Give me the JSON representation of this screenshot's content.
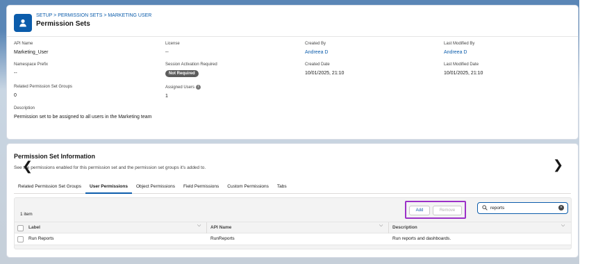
{
  "header": {
    "breadcrumb": "SETUP > PERMISSION SETS > MARKETING USER",
    "title": "Permission Sets",
    "icon": "user-icon"
  },
  "details": {
    "api_name": {
      "label": "API Name",
      "value": "Marketing_User"
    },
    "license": {
      "label": "License",
      "value": "--"
    },
    "created_by": {
      "label": "Created By",
      "value": "Andreea D"
    },
    "last_modified_by": {
      "label": "Last Modified By",
      "value": "Andreea D"
    },
    "namespace_prefix": {
      "label": "Namespace Prefix",
      "value": "--"
    },
    "session_activation": {
      "label": "Session Activation Required",
      "value": "Not Required"
    },
    "created_date": {
      "label": "Created Date",
      "value": "10/01/2025, 21:10"
    },
    "last_modified_date": {
      "label": "Last Modified Date",
      "value": "10/01/2025, 21:10"
    },
    "related_groups": {
      "label": "Related Permission Set Groups",
      "value": "0"
    },
    "assigned_users": {
      "label": "Assigned Users",
      "value": "1"
    },
    "description": {
      "label": "Description",
      "value": "Permission set to be assigned to all users in the Marketing team"
    }
  },
  "info_section": {
    "title": "Permission Set Information",
    "subtitle": "See the permissions enabled for this permission set and the permission set groups it's added to.",
    "tabs": [
      {
        "label": "Related Permission Set Groups"
      },
      {
        "label": "User Permissions"
      },
      {
        "label": "Object Permissions"
      },
      {
        "label": "Field Permissions"
      },
      {
        "label": "Custom Permissions"
      },
      {
        "label": "Tabs"
      }
    ],
    "active_tab": "User Permissions",
    "item_count": "1 item",
    "add_label": "Add",
    "remove_label": "Remove",
    "search_value": "reports",
    "columns": [
      "Label",
      "API Name",
      "Description"
    ],
    "rows": [
      {
        "label": "Run Reports",
        "api_name": "RunReports",
        "description": "Run reports and dashboards."
      }
    ]
  },
  "colors": {
    "brand": "#0b5cab",
    "highlight": "#9b30c8"
  }
}
